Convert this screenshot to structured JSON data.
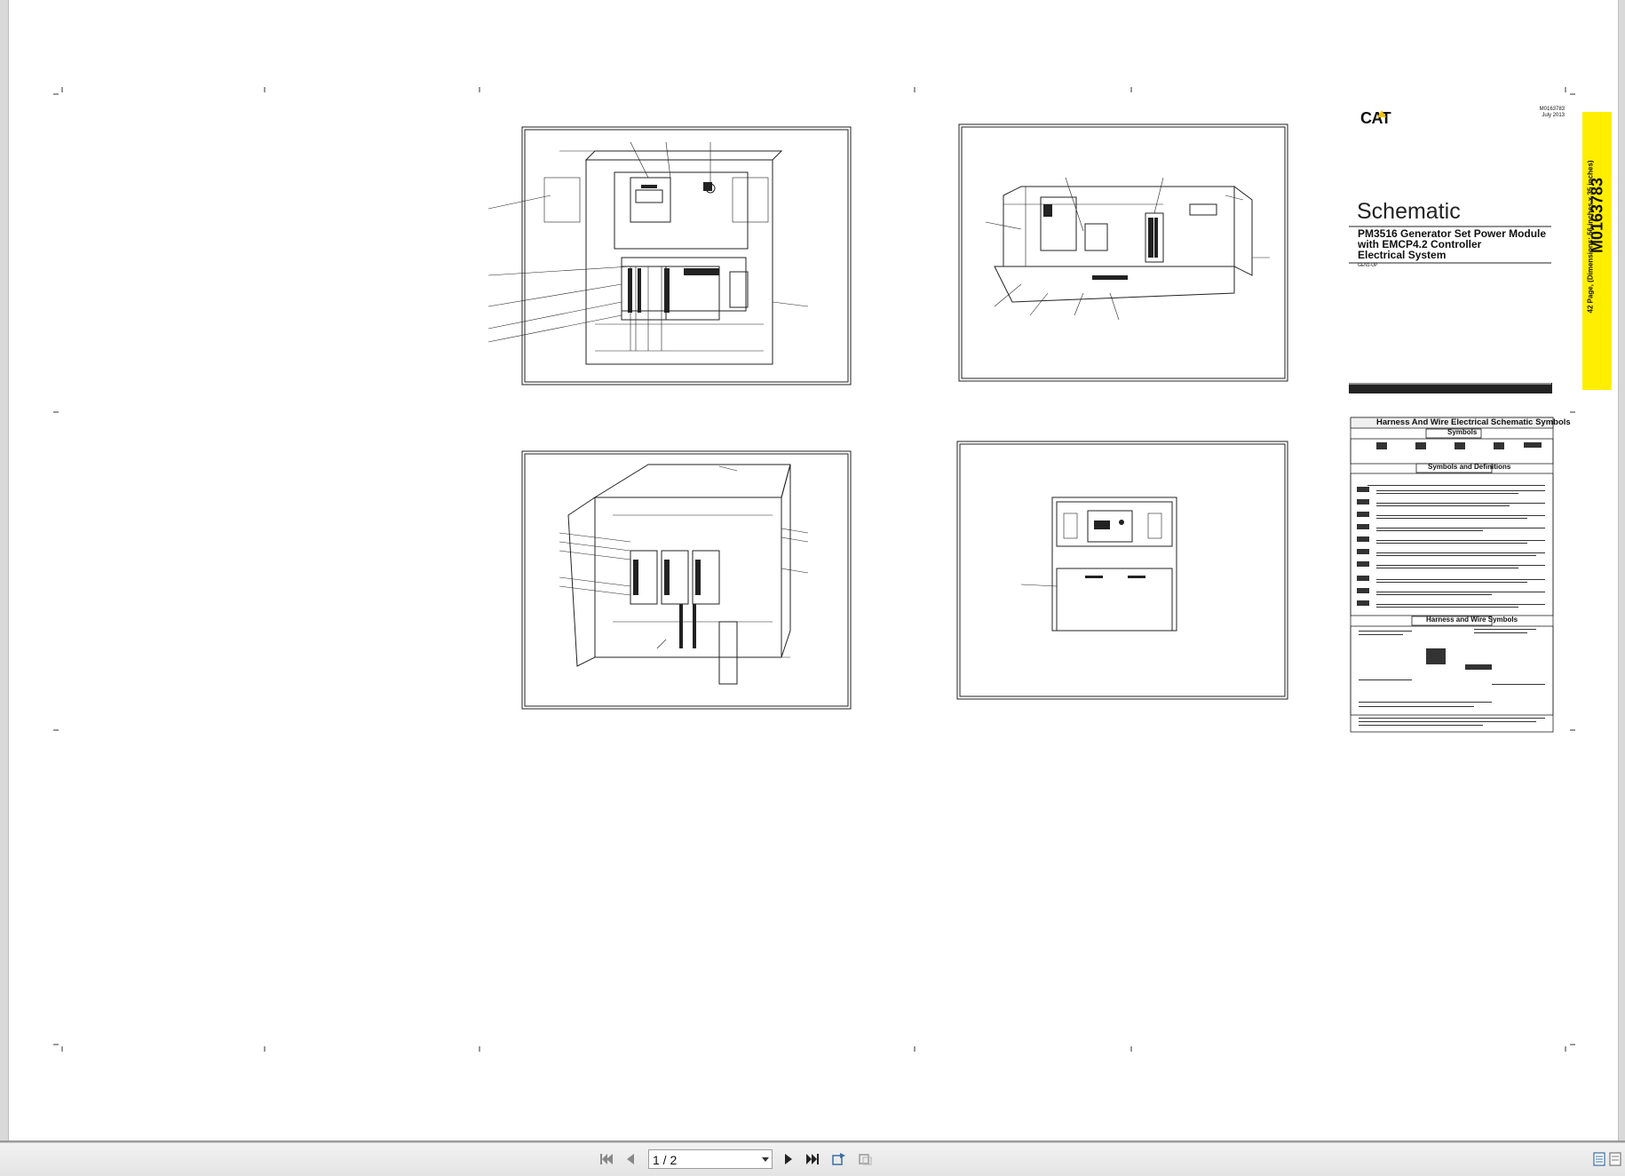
{
  "document": {
    "brand": "CAT",
    "doc_id_small": "M0163783",
    "date": "July 2013",
    "title": "Schematic",
    "subtitle_lines": [
      "PM3516 Generator Set Power Module",
      "with EMCP4.2 Controller",
      "Electrical System"
    ],
    "serial_tag": "GEN1-UP",
    "tab_id": "M0163783",
    "tab_pages": "42 Page, (Dimensions: 56 inches x 35 inches)"
  },
  "legend": {
    "title": "Harness And Wire Electrical Schematic Symbols",
    "symbols_header": "Symbols",
    "symbols_defs_header": "Symbols and Definitions",
    "harness_header": "Harness and Wire Symbols"
  },
  "toolbar": {
    "page_value": "1 / 2",
    "icons": [
      "first-page-icon",
      "prev-page-icon",
      "next-page-icon",
      "last-page-icon",
      "tool-icon-1",
      "tool-icon-2",
      "single-page-view-icon",
      "two-page-view-icon"
    ]
  },
  "colors": {
    "accent_yellow": "#ffee00",
    "frame_gray": "#d9d9d9",
    "toolbar_bg": "#ececec"
  }
}
